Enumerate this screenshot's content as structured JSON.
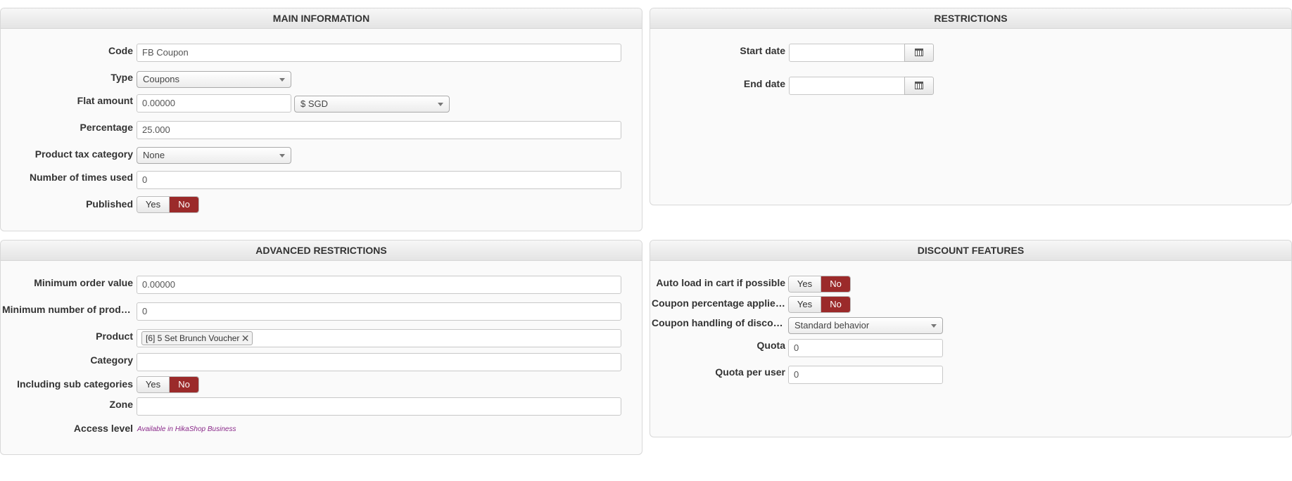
{
  "main_information": {
    "title": "MAIN INFORMATION",
    "code": {
      "label": "Code",
      "value": "FB Coupon"
    },
    "type": {
      "label": "Type",
      "value": "Coupons"
    },
    "flat_amount": {
      "label": "Flat amount",
      "value": "0.00000",
      "currency": "$ SGD"
    },
    "percentage": {
      "label": "Percentage",
      "value": "25.000"
    },
    "product_tax_category": {
      "label": "Product tax category",
      "value": "None"
    },
    "times_used": {
      "label": "Number of times used",
      "value": "0"
    },
    "published": {
      "label": "Published",
      "yes": "Yes",
      "no": "No",
      "selected": "No"
    }
  },
  "restrictions": {
    "title": "RESTRICTIONS",
    "start_date": {
      "label": "Start date",
      "value": ""
    },
    "end_date": {
      "label": "End date",
      "value": ""
    }
  },
  "advanced_restrictions": {
    "title": "ADVANCED RESTRICTIONS",
    "min_order_value": {
      "label": "Minimum order value",
      "value": "0.00000"
    },
    "min_products": {
      "label": "Minimum number of produ...",
      "value": "0"
    },
    "product": {
      "label": "Product",
      "tags": [
        "[6] 5 Set Brunch Voucher"
      ],
      "remove_glyph": "✕"
    },
    "category": {
      "label": "Category",
      "value": ""
    },
    "sub_categories": {
      "label": "Including sub categories",
      "yes": "Yes",
      "no": "No",
      "selected": "No"
    },
    "zone": {
      "label": "Zone",
      "value": ""
    },
    "access_level": {
      "label": "Access level",
      "note": "Available in HikaShop Business"
    }
  },
  "discount_features": {
    "title": "DISCOUNT FEATURES",
    "auto_load": {
      "label": "Auto load in cart if possible",
      "yes": "Yes",
      "no": "No",
      "selected": "No"
    },
    "percentage_applies": {
      "label": "Coupon percentage applies...",
      "yes": "Yes",
      "no": "No",
      "selected": "No"
    },
    "handling": {
      "label": "Coupon handling of discou...",
      "value": "Standard behavior"
    },
    "quota": {
      "label": "Quota",
      "value": "0"
    },
    "quota_per_user": {
      "label": "Quota per user",
      "value": "0"
    }
  },
  "colors": {
    "toggle_no_active": "#9b2a2a",
    "note_text": "#8a2a8a"
  }
}
